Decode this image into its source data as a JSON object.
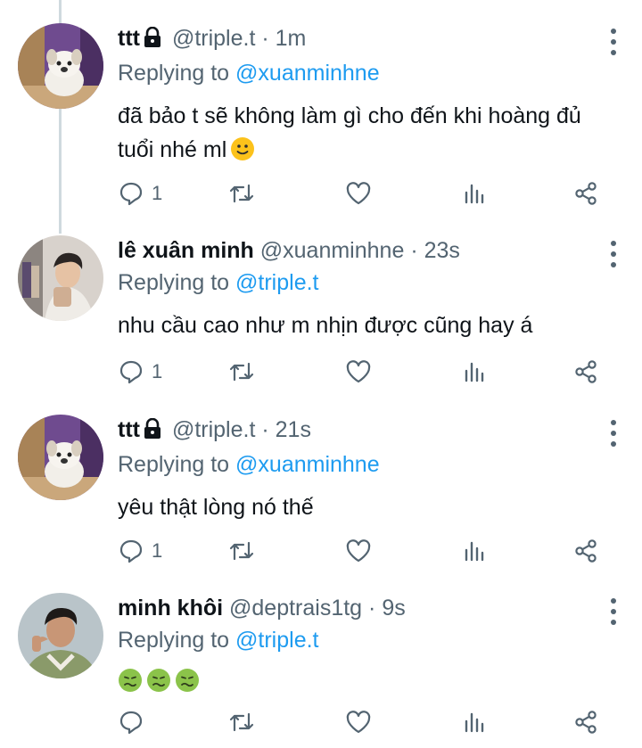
{
  "tweets": [
    {
      "name": "ttt",
      "handle": "@triple.t",
      "time": "· 1m",
      "replying_prefix": "Replying to",
      "replying_to": "@xuanminhne",
      "text": "đã bảo t sẽ không làm gì cho đến khi hoàng đủ tuổi nhé ml",
      "emoji": "slightly-smiling-face",
      "reply_count": "1",
      "locked": true
    },
    {
      "name": "lê xuân minh",
      "handle": "@xuanminhne",
      "time": "· 23s",
      "replying_prefix": "Replying to",
      "replying_to": "@triple.t",
      "text": "nhu cầu cao như m nhịn được cũng hay á",
      "reply_count": "1",
      "locked": false
    },
    {
      "name": "ttt",
      "handle": "@triple.t",
      "time": "· 21s",
      "replying_prefix": "Replying to",
      "replying_to": "@xuanminhne",
      "text": "yêu thật lòng nó thế",
      "reply_count": "1",
      "locked": true
    },
    {
      "name": "minh khôi",
      "handle": "@deptrais1tg",
      "time": "· 9s",
      "replying_prefix": "Replying to",
      "replying_to": "@triple.t",
      "emoji": [
        "nauseated-face",
        "nauseated-face",
        "nauseated-face"
      ],
      "reply_count": "",
      "locked": false
    }
  ],
  "icons": [
    "reply-icon",
    "retweet-icon",
    "like-icon",
    "analytics-icon",
    "share-icon",
    "lock-icon",
    "more-icon"
  ],
  "colors": {
    "link": "#1d9bf0",
    "secondary": "#536471",
    "text": "#0f1419",
    "thread_line": "#cfd9de"
  }
}
